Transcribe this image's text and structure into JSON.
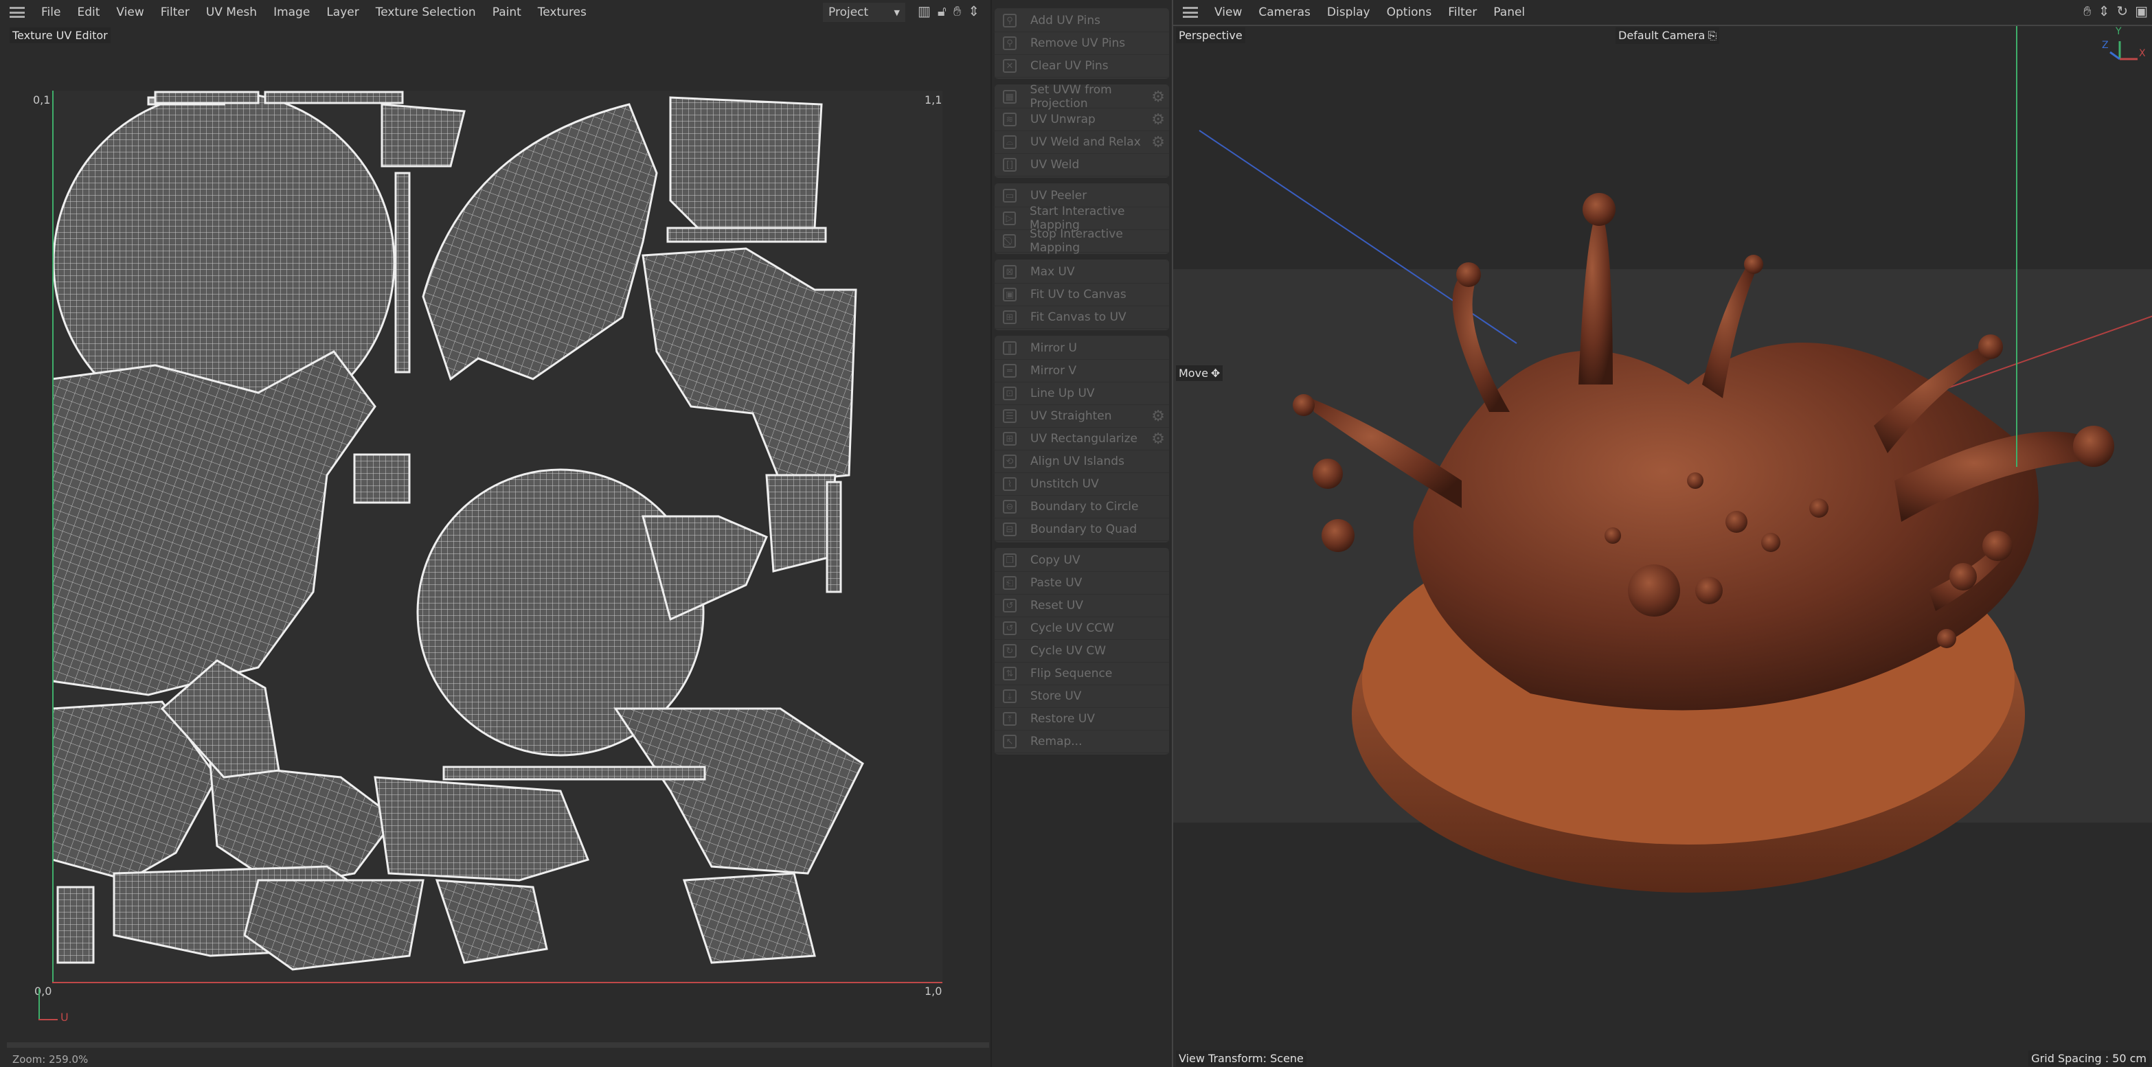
{
  "uv_editor": {
    "menu": [
      "File",
      "Edit",
      "View",
      "Filter",
      "UV Mesh",
      "Image",
      "Layer",
      "Texture Selection",
      "Paint",
      "Textures"
    ],
    "project_select": "Project",
    "title": "Texture UV Editor",
    "corner_labels": {
      "top_left": "0,1",
      "top_right": "1,1",
      "bottom_left": "0,0",
      "bottom_right": "1,0"
    },
    "axis_u": "U",
    "zoom": "Zoom: 259.0%"
  },
  "tools": {
    "groups": [
      [
        {
          "label": "Add UV Pins",
          "icon": "pin-icon"
        },
        {
          "label": "Remove UV Pins",
          "icon": "unpin-icon"
        },
        {
          "label": "Clear UV Pins",
          "icon": "close-icon"
        }
      ],
      [
        {
          "label": "Set UVW from Projection",
          "icon": "checker-icon",
          "gear": true
        },
        {
          "label": "UV Unwrap",
          "icon": "unwrap-icon",
          "gear": true
        },
        {
          "label": "UV Weld and Relax",
          "icon": "weld-relax-icon",
          "gear": true
        },
        {
          "label": "UV Weld",
          "icon": "weld-icon"
        }
      ],
      [
        {
          "label": "UV Peeler",
          "icon": "peeler-icon"
        },
        {
          "label": "Start Interactive Mapping",
          "icon": "play-icon"
        },
        {
          "label": "Stop Interactive Mapping",
          "icon": "stop-icon"
        }
      ],
      [
        {
          "label": "Max UV",
          "icon": "max-uv-icon"
        },
        {
          "label": "Fit UV to Canvas",
          "icon": "fit-uv-icon"
        },
        {
          "label": "Fit Canvas to UV",
          "icon": "fit-canvas-icon"
        }
      ],
      [
        {
          "label": "Mirror U",
          "icon": "mirror-u-icon"
        },
        {
          "label": "Mirror V",
          "icon": "mirror-v-icon"
        },
        {
          "label": "Line Up UV",
          "icon": "line-up-icon"
        },
        {
          "label": "UV Straighten",
          "icon": "straighten-icon",
          "gear": true
        },
        {
          "label": "UV Rectangularize",
          "icon": "rectangularize-icon",
          "gear": true
        },
        {
          "label": "Align UV Islands",
          "icon": "align-icon"
        },
        {
          "label": "Unstitch UV",
          "icon": "unstitch-icon"
        },
        {
          "label": "Boundary to Circle",
          "icon": "circle-icon"
        },
        {
          "label": "Boundary to Quad",
          "icon": "quad-icon"
        }
      ],
      [
        {
          "label": "Copy UV",
          "icon": "copy-icon"
        },
        {
          "label": "Paste UV",
          "icon": "paste-icon"
        },
        {
          "label": "Reset UV",
          "icon": "reset-icon"
        },
        {
          "label": "Cycle UV CCW",
          "icon": "cycle-ccw-icon"
        },
        {
          "label": "Cycle UV CW",
          "icon": "cycle-cw-icon"
        },
        {
          "label": "Flip Sequence",
          "icon": "flip-icon"
        },
        {
          "label": "Store UV",
          "icon": "store-icon"
        },
        {
          "label": "Restore UV",
          "icon": "restore-icon"
        },
        {
          "label": "Remap...",
          "icon": "remap-icon"
        }
      ]
    ]
  },
  "viewport": {
    "menu": [
      "View",
      "Cameras",
      "Display",
      "Options",
      "Filter",
      "Panel"
    ],
    "view_name": "Perspective",
    "camera": "Default Camera",
    "tool": "Move",
    "axes": {
      "x": "X",
      "y": "Y",
      "z": "Z"
    },
    "view_transform": "View Transform: Scene",
    "grid_spacing": "Grid Spacing : 50 cm"
  },
  "colors": {
    "chocolate": "#6a3220",
    "u_axis": "#c04848",
    "v_axis": "#3fae6a"
  }
}
